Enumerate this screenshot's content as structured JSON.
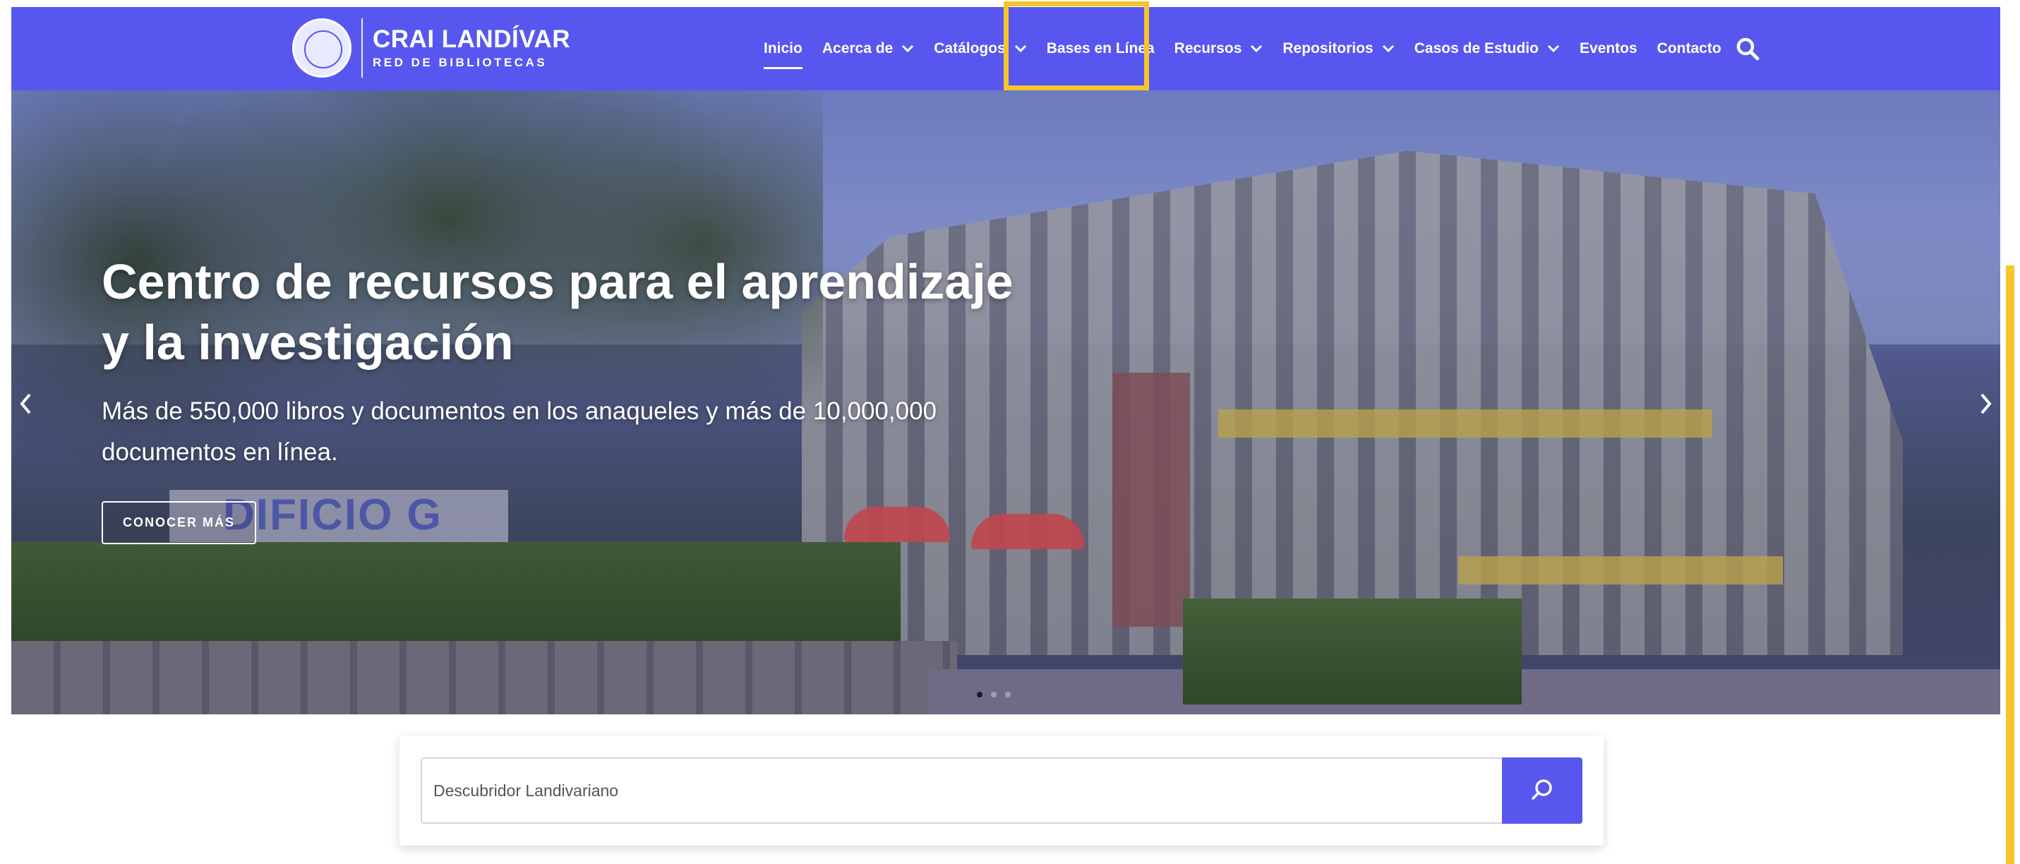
{
  "brand": {
    "title": "CRAI LANDÍVAR",
    "subtitle": "RED DE BIBLIOTECAS"
  },
  "nav": {
    "items": [
      {
        "label": "Inicio",
        "has_dropdown": false,
        "active": true
      },
      {
        "label": "Acerca de",
        "has_dropdown": true
      },
      {
        "label": "Catálogos",
        "has_dropdown": true
      },
      {
        "label": "Bases en Línea",
        "has_dropdown": false
      },
      {
        "label": "Recursos",
        "has_dropdown": true
      },
      {
        "label": "Repositorios",
        "has_dropdown": true
      },
      {
        "label": "Casos de Estudio",
        "has_dropdown": true
      },
      {
        "label": "Eventos",
        "has_dropdown": false
      },
      {
        "label": "Contacto",
        "has_dropdown": false
      }
    ],
    "search_icon": "search-icon"
  },
  "hero": {
    "title_line1": "Centro de recursos para el aprendizaje",
    "title_line2": "y la investigación",
    "description": "Más de 550,000 libros y documentos en los anaqueles y más de 10,000,000 documentos en línea.",
    "cta_label": "CONOCER MÁS",
    "sign_text": "DIFICIO G",
    "slides": 3,
    "active_slide": 1
  },
  "search": {
    "placeholder": "Descubridor Landivariano"
  },
  "colors": {
    "brand": "#5757f0",
    "highlight": "#f7c52a",
    "white": "#ffffff"
  }
}
